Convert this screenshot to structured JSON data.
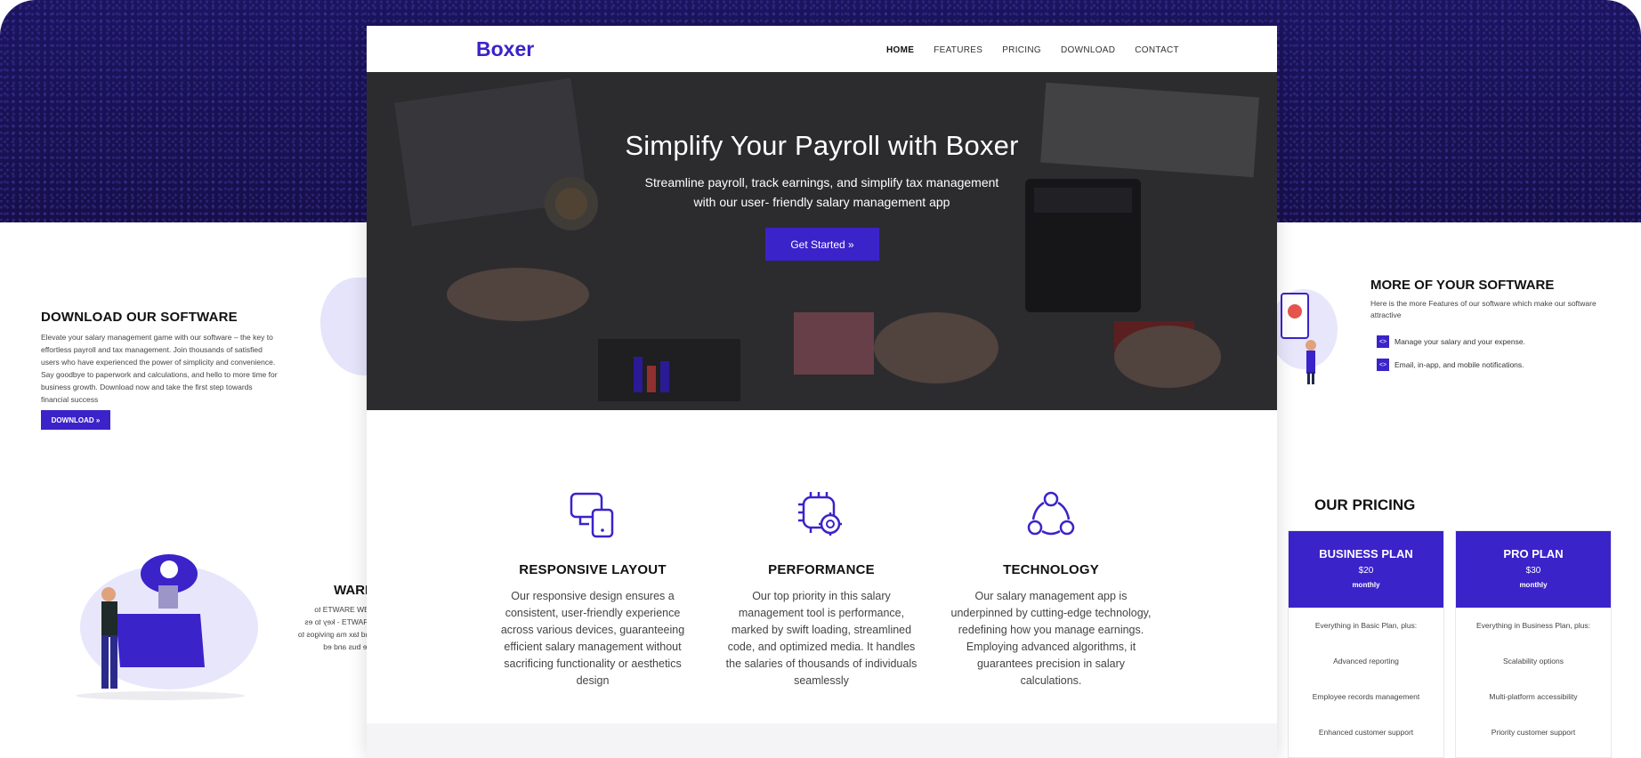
{
  "colors": {
    "accent": "#3a23c9",
    "frame_dark": "#16104b"
  },
  "left_panel": {
    "title": "DOWNLOAD OUR SOFTWARE",
    "text": "Elevate your salary management game with our software – the key to effortless payroll and tax management. Join thousands of satisfied users who have experienced the power of simplicity and convenience. Say goodbye to paperwork and calculations, and hello to more time for business growth. Download now and take the first step towards financial success",
    "button": "DOWNLOAD »",
    "mirrored_title": "ƎЯAW",
    "mirrored_text": "- ƎW ƎЯAWTƎ to ƎЯAWTƎ - key to es and tax ma gnivigos to are bus and ed"
  },
  "right_panel": {
    "title": "MORE OF YOUR SOFTWARE",
    "text": "Here is the more Features of our software which make our software attractive",
    "items": [
      "Manage your salary and your expense.",
      "Email, in-app, and mobile notifications."
    ],
    "pricing_title": "OUR PRICING",
    "plans": [
      {
        "name": "BUSINESS PLAN",
        "price": "$20",
        "period": "monthly",
        "features": [
          "Everything in Basic Plan, plus:",
          "Advanced reporting",
          "Employee records management",
          "Enhanced customer support"
        ]
      },
      {
        "name": "PRO PLAN",
        "price": "$30",
        "period": "monthly",
        "features": [
          "Everything in Business Plan, plus:",
          "Scalability options",
          "Multi-platform accessibility",
          "Priority customer support"
        ]
      }
    ]
  },
  "site": {
    "brand": "Boxer",
    "menu": [
      "HOME",
      "FEATURES",
      "PRICING",
      "DOWNLOAD",
      "CONTACT"
    ],
    "hero": {
      "title": "Simplify Your Payroll with Boxer",
      "subtitle_line1": "Streamline payroll, track earnings, and simplify tax management",
      "subtitle_line2": "with our user- friendly salary management app",
      "button": "Get Started »"
    },
    "features": [
      {
        "icon": "devices-icon",
        "title": "RESPONSIVE LAYOUT",
        "text": "Our responsive design ensures a consistent, user-friendly experience across various devices, guaranteeing efficient salary management without sacrificing functionality or aesthetics design"
      },
      {
        "icon": "chip-gear-icon",
        "title": "PERFORMANCE",
        "text": "Our top priority in this salary management tool is performance, marked by swift loading, streamlined code, and optimized media. It handles the salaries of thousands of individuals seamlessly"
      },
      {
        "icon": "network-icon",
        "title": "TECHNOLOGY",
        "text": "Our salary management app is underpinned by cutting-edge technology, redefining how you manage earnings. Employing advanced algorithms, it guarantees precision in salary calculations."
      }
    ]
  }
}
